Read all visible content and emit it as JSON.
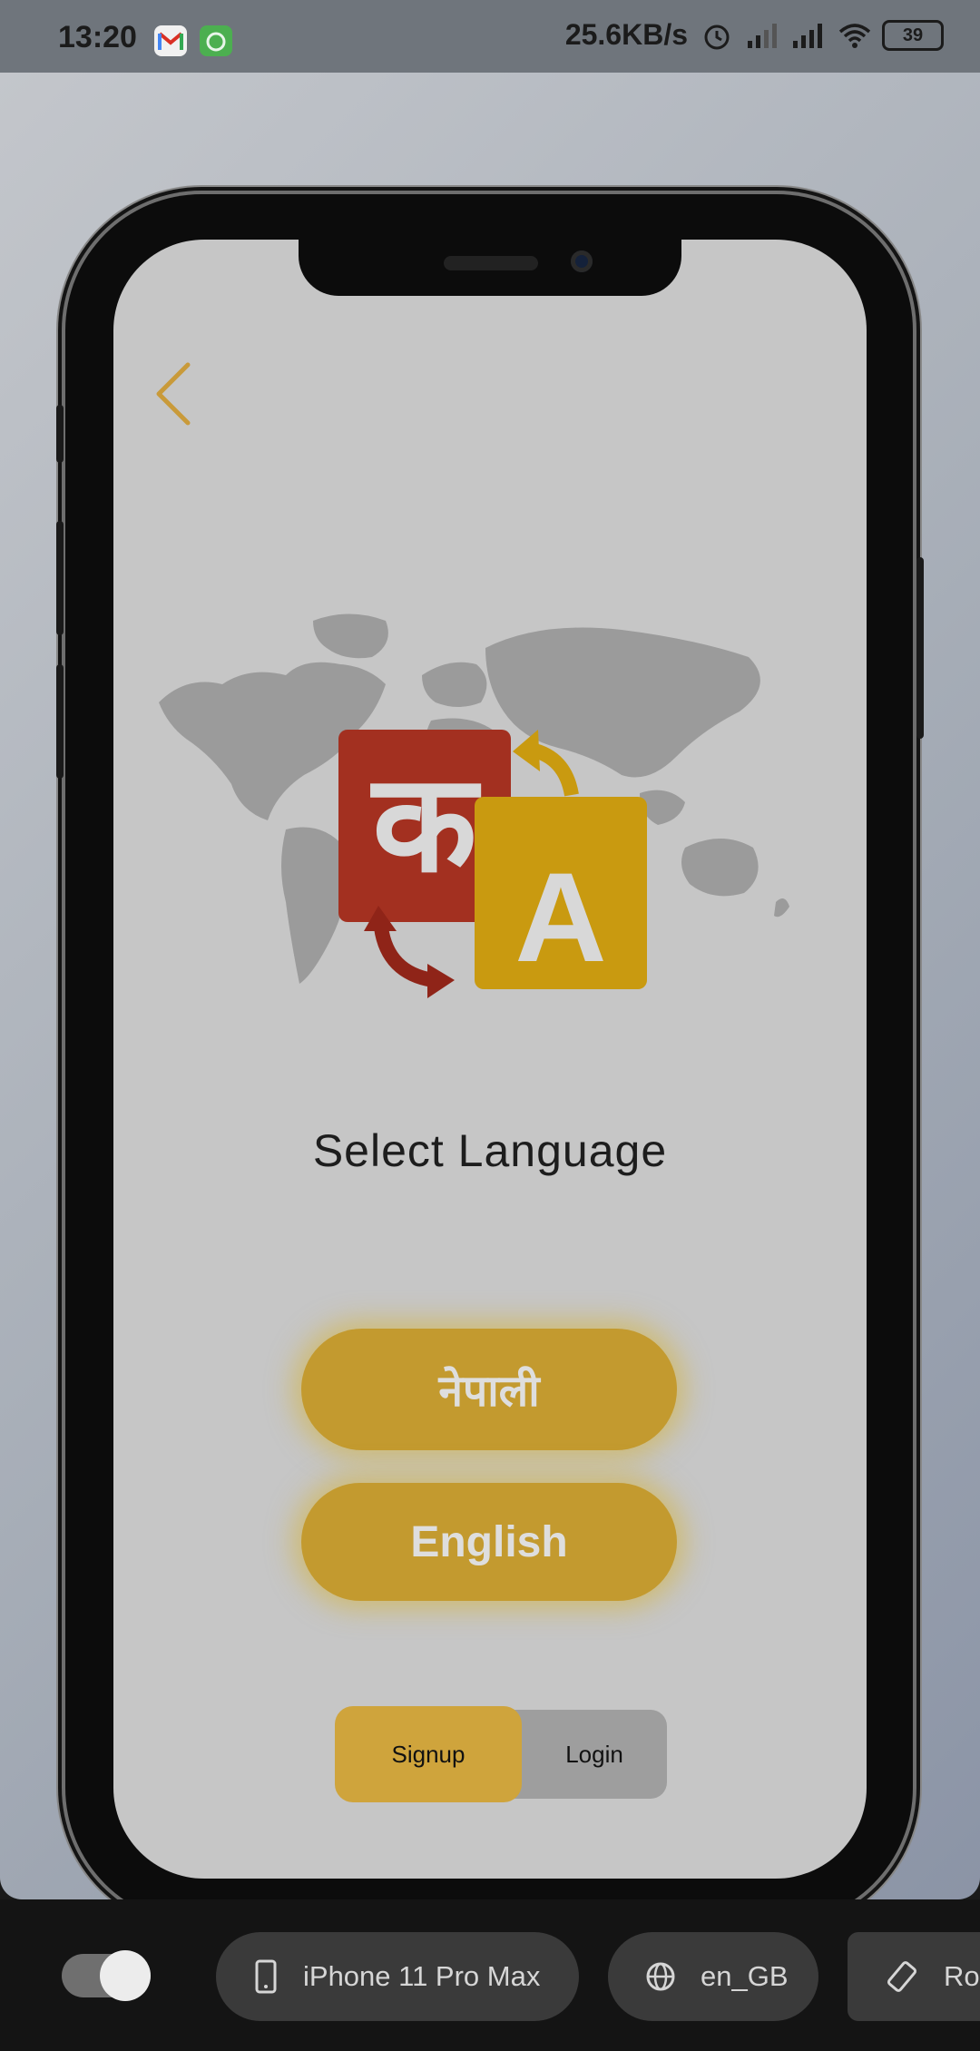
{
  "status_bar": {
    "time": "13:20",
    "net_speed": "25.6KB/s",
    "battery": "39",
    "icons": [
      "gmail-icon",
      "app-icon",
      "alarm-icon",
      "signal-icon",
      "signal-icon",
      "wifi-icon",
      "battery-icon"
    ]
  },
  "app": {
    "title": "Select Language",
    "languages": [
      "नेपाली",
      "English"
    ],
    "auth_toggle": {
      "signup": "Signup",
      "login": "Login",
      "selected": "Signup"
    },
    "hero_letters": {
      "devanagari": "क",
      "latin": "A"
    },
    "colors": {
      "accent": "#c39a2f",
      "red_tile": "#a33020",
      "yellow_tile": "#c99a10",
      "screen_bg": "#c6c6c6"
    }
  },
  "toolbar": {
    "device": "iPhone 11 Pro Max",
    "locale": "en_GB",
    "rotate": "Rot",
    "preview_enabled": true
  }
}
